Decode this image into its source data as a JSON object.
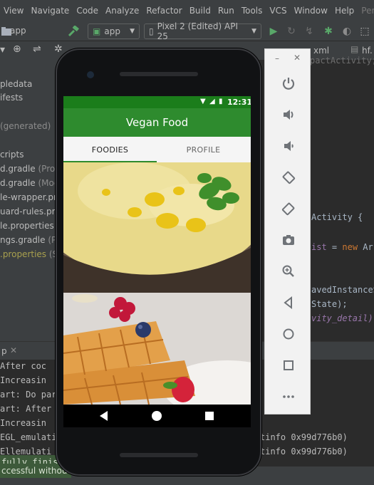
{
  "menubar": {
    "items": [
      "View",
      "Navigate",
      "Code",
      "Analyze",
      "Refactor",
      "Build",
      "Run",
      "Tools",
      "VCS",
      "Window",
      "Help",
      "Pertem"
    ]
  },
  "toolbar": {
    "module_label": "app",
    "run_config": "app",
    "device": "Pixel 2 (Edited) API 25"
  },
  "editor_tabs": {
    "tab1": "xml",
    "tab2": "hf."
  },
  "tree": {
    "items": [
      {
        "text": "pledata",
        "sub": ""
      },
      {
        "text": "ifests",
        "sub": ""
      },
      {
        "text": "(generated)",
        "sub": ""
      },
      {
        "text": "cripts",
        "sub": ""
      },
      {
        "text": "d.gradle",
        "sub": "(Projec"
      },
      {
        "text": "d.gradle",
        "sub": "(Modu"
      },
      {
        "text": "le-wrapper.pro",
        "sub": ""
      },
      {
        "text": "uard-rules.pro",
        "sub": ""
      },
      {
        "text": "le.properties",
        "sub": "(P"
      },
      {
        "text": "ngs.gradle",
        "sub": "(Pro"
      },
      {
        "text": ".properties",
        "sub": "(SD"
      }
    ]
  },
  "editor": {
    "lines": [
      {
        "a": "pactActivity;",
        "b": ""
      },
      {
        "a": "Activity {",
        "b": ""
      },
      {
        "a": "= new Arr",
        "b": "ist"
      },
      {
        "a": "avedInstanceS",
        "b": ""
      },
      {
        "a": "State);",
        "b": ""
      },
      {
        "a": "vity_detail);",
        "b": ""
      }
    ]
  },
  "run": {
    "title": "p",
    "lines": [
      "    After coc",
      "    Increasin",
      "art: Do par",
      "art: After",
      "    Increasin",
      "EGL_emulati",
      "Ellemulati"
    ],
    "right_lines": [
      "tinfo 0x99d776b0)",
      "tinfo 0x99d776b0)"
    ],
    "toast1": "fully finished in",
    "toast2": "ccessful without"
  },
  "emulator": {
    "time": "12:31",
    "app_title": "Vegan Food",
    "tabs": [
      "FOODIES",
      "PROFILE"
    ],
    "selected_tab": 0
  },
  "side_panel": {
    "buttons": [
      "power-icon",
      "volume-up-icon",
      "volume-down-icon",
      "rotate-left-icon",
      "rotate-right-icon",
      "camera-icon",
      "zoom-icon",
      "back-icon",
      "home-icon",
      "overview-icon",
      "more-icon"
    ]
  },
  "colors": {
    "appbar": "#2e8b2e",
    "statusbar": "#1b7d1b",
    "ide_bg": "#2b2b2b"
  }
}
